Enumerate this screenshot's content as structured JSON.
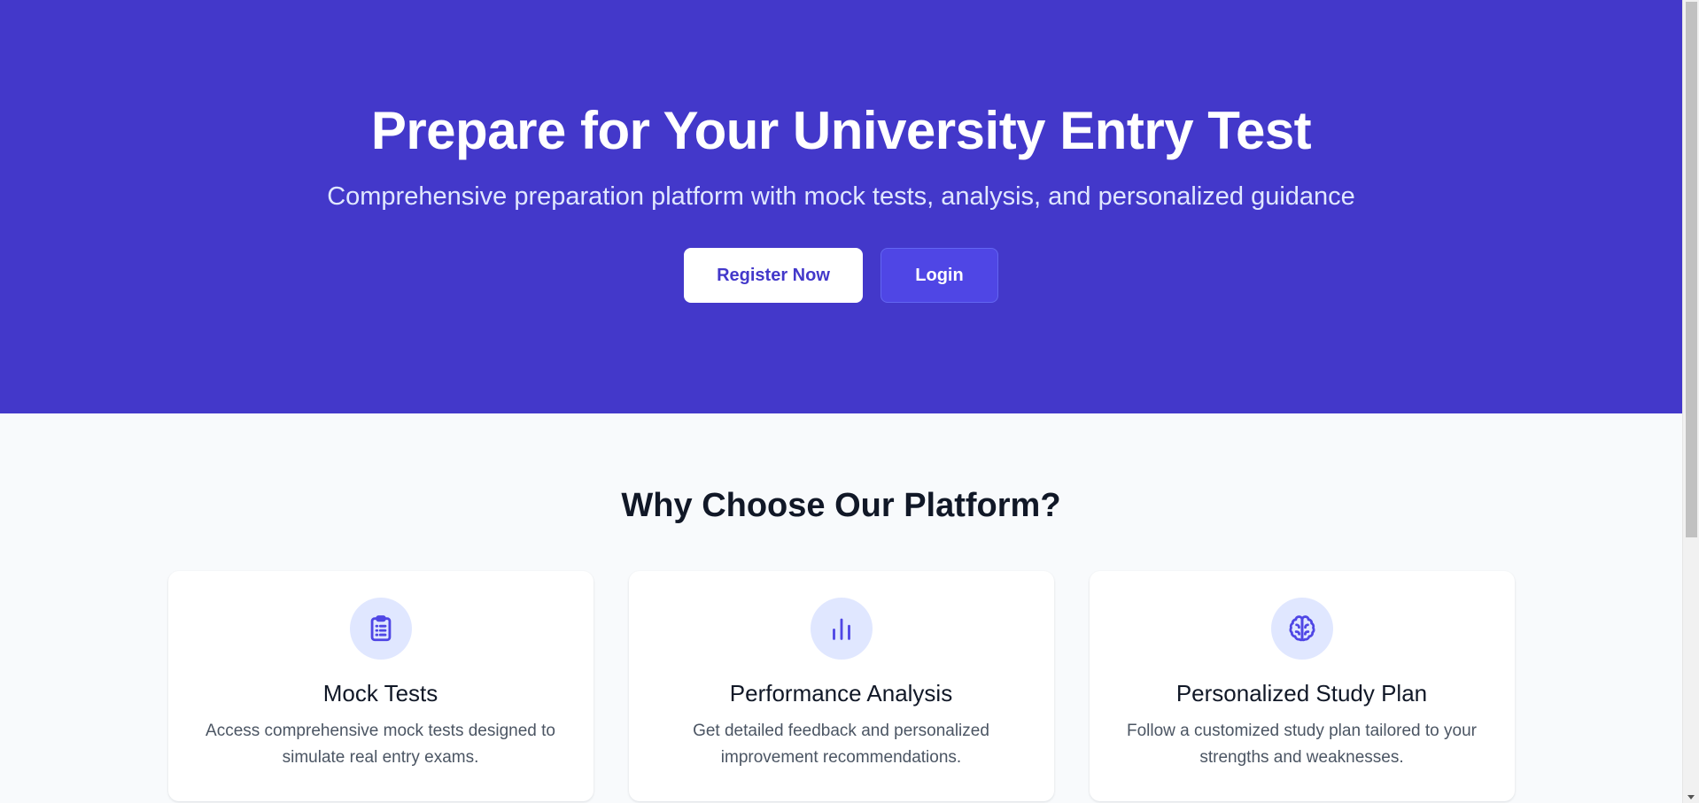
{
  "hero": {
    "title": "Prepare for Your University Entry Test",
    "subtitle": "Comprehensive preparation platform with mock tests, analysis, and personalized guidance",
    "register_label": "Register Now",
    "login_label": "Login"
  },
  "features": {
    "title": "Why Choose Our Platform?",
    "cards": [
      {
        "icon": "clipboard-list-icon",
        "title": "Mock Tests",
        "text": "Access comprehensive mock tests designed to simulate real entry exams."
      },
      {
        "icon": "bar-chart-icon",
        "title": "Performance Analysis",
        "text": "Get detailed feedback and personalized improvement recommendations."
      },
      {
        "icon": "brain-icon",
        "title": "Personalized Study Plan",
        "text": "Follow a customized study plan tailored to your strengths and weaknesses."
      }
    ]
  },
  "colors": {
    "hero_bg": "#4338ca",
    "accent": "#4f46e5",
    "icon_bg": "#e0e7ff",
    "page_bg": "#f8fafc"
  }
}
